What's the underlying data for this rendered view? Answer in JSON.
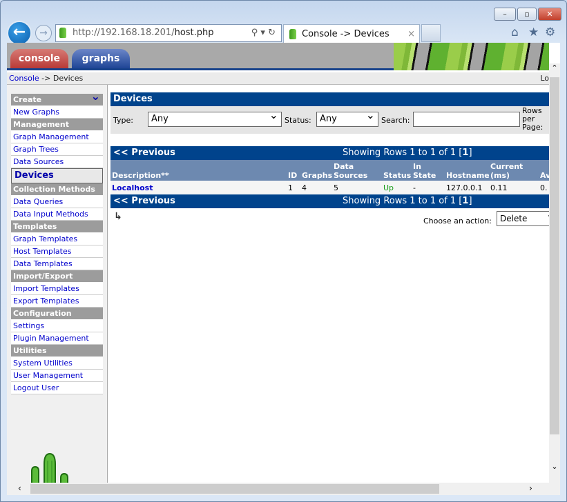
{
  "browser": {
    "url_host": "http://192.168.18.201/",
    "url_path": "host.php",
    "tab_title": "Console -> Devices",
    "tab_close": "×",
    "back": "←",
    "forward": "→",
    "window_buttons": [
      "–",
      "▫",
      "✕"
    ],
    "tools": [
      "home-icon",
      "star-icon",
      "gear-icon"
    ]
  },
  "header": {
    "tabs": [
      {
        "label": "console",
        "color": "#b83a37"
      },
      {
        "label": "graphs",
        "color": "#1f4596"
      }
    ],
    "accent": "#00438c"
  },
  "breadcrumb": {
    "link": "Console",
    "rest": " -> Devices",
    "right": "Lo"
  },
  "sidebar": {
    "sections": [
      {
        "title": "Create",
        "items": [
          "New Graphs"
        ]
      },
      {
        "title": "Management",
        "items": [
          "Graph Management",
          "Graph Trees",
          "Data Sources",
          "Devices"
        ]
      },
      {
        "title": "Collection Methods",
        "items": [
          "Data Queries",
          "Data Input Methods"
        ]
      },
      {
        "title": "Templates",
        "items": [
          "Graph Templates",
          "Host Templates",
          "Data Templates"
        ]
      },
      {
        "title": "Import/Export",
        "items": [
          "Import Templates",
          "Export Templates"
        ]
      },
      {
        "title": "Configuration",
        "items": [
          "Settings",
          "Plugin Management"
        ]
      },
      {
        "title": "Utilities",
        "items": [
          "System Utilities",
          "User Management",
          "Logout User"
        ]
      }
    ],
    "selected": "Devices"
  },
  "main": {
    "title": "Devices",
    "filters": {
      "type_label": "Type:",
      "type_value": "Any",
      "status_label": "Status:",
      "status_value": "Any",
      "search_label": "Search:",
      "search_value": "",
      "rows_label": "Rows per Page:"
    },
    "nav": {
      "previous": "<< Previous",
      "showing": "Showing Rows 1 to 1 of 1 [",
      "page": "1",
      "close": "]"
    },
    "table": {
      "columns": [
        "Description**",
        "ID",
        "Graphs",
        "Data Sources",
        "Status",
        "In State",
        "Hostname",
        "Current (ms)",
        "Average (ms)"
      ],
      "rows": [
        {
          "description": "Localhost",
          "id": "1",
          "graphs": "4",
          "data_sources": "5",
          "status": "Up",
          "in_state": "-",
          "hostname": "127.0.0.1",
          "current": "0.11",
          "average": "0."
        }
      ]
    },
    "action_label": "Choose an action:",
    "action_value": "Delete",
    "status_up_color": "#119911"
  }
}
